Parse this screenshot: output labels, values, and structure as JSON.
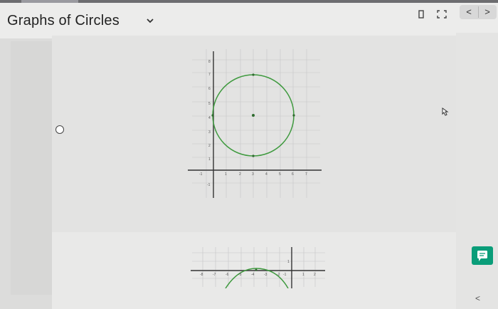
{
  "header": {
    "title": "Graphs of Circles",
    "nav_prev": "<",
    "nav_next": ">"
  },
  "icons": {
    "title_dropdown": "chevron-down-icon",
    "toolbar_left": "bookmark-icon",
    "toolbar_right": "expand-icon",
    "feedback": "chat-icon",
    "collapse": "chevron-left-icon"
  },
  "graph_1": {
    "x_tick_labels": [
      "-1",
      "1",
      "2",
      "3",
      "4",
      "5",
      "6",
      "7"
    ],
    "y_tick_labels": [
      "8",
      "7",
      "6",
      "5",
      "4",
      "3",
      "2",
      "1",
      "-1"
    ]
  },
  "graph_2": {
    "x_tick_labels": [
      "-8",
      "-7",
      "-6",
      "-5",
      "-4",
      "-3",
      "-2",
      "-1",
      "1",
      "2"
    ],
    "y_tick_labels": [
      "1"
    ]
  },
  "colors": {
    "circle_stroke": "#3f9a3f",
    "feedback_button": "#0a9d79"
  },
  "footer": {
    "back_label": "<"
  }
}
